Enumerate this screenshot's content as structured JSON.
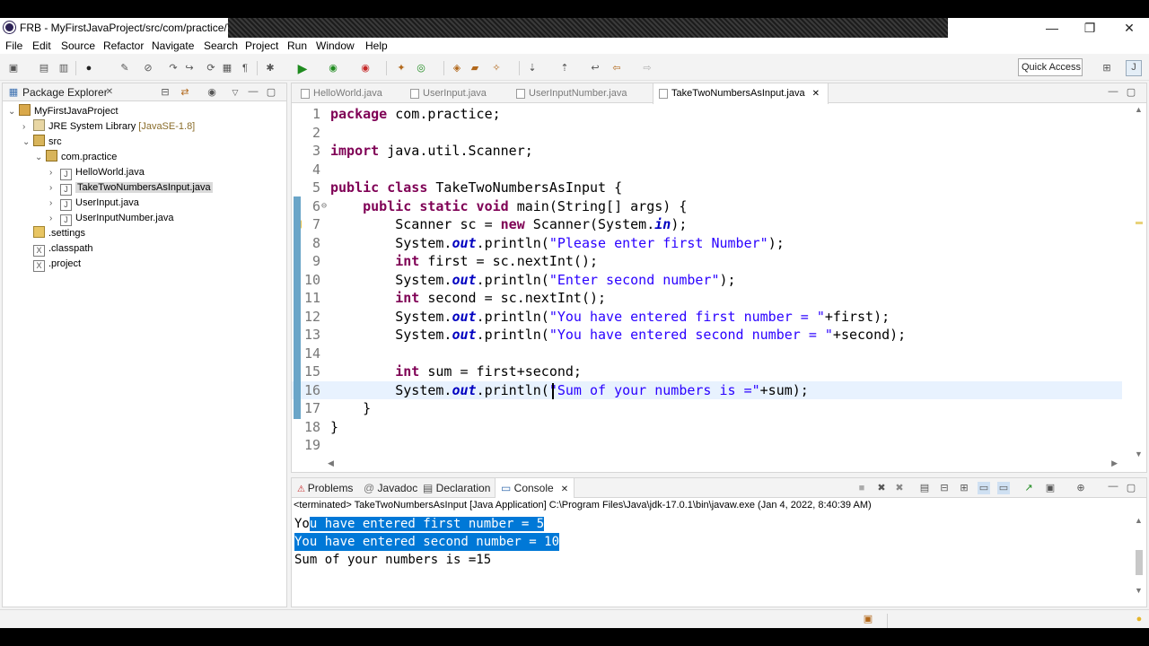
{
  "window": {
    "title": "FRB - MyFirstJavaProject/src/com/practice/TakeTwoNumbersAsInput.java - Eclipse IDE",
    "minimize": "—",
    "maximize": "❐",
    "close": "✕"
  },
  "menu": [
    "File",
    "Edit",
    "Source",
    "Refactor",
    "Navigate",
    "Search",
    "Project",
    "Run",
    "Window",
    "Help"
  ],
  "toolbar": {
    "quick_access": "Quick Access"
  },
  "package_explorer": {
    "title": "Package Explorer",
    "close": "✕",
    "project": "MyFirstJavaProject",
    "jre": "JRE System Library",
    "jre_version": "[JavaSE-1.8]",
    "src": "src",
    "package": "com.practice",
    "files": [
      "HelloWorld.java",
      "TakeTwoNumbersAsInput.java",
      "UserInput.java",
      "UserInputNumber.java"
    ],
    "others": [
      ".settings",
      ".classpath",
      ".project"
    ]
  },
  "editor": {
    "tabs": [
      "HelloWorld.java",
      "UserInput.java",
      "UserInputNumber.java",
      "TakeTwoNumbersAsInput.java"
    ],
    "active_tab": "TakeTwoNumbersAsInput.java",
    "tab_close": "✕",
    "line_numbers": [
      "1",
      "2",
      "3",
      "4",
      "5",
      "6",
      "7",
      "8",
      "9",
      "10",
      "11",
      "12",
      "13",
      "14",
      "15",
      "16",
      "17",
      "18",
      "19"
    ],
    "fold_marker": "⊖",
    "code": {
      "l1_kw": "package",
      "l1_rest": " com.practice;",
      "l3_kw": "import",
      "l3_rest": " java.util.Scanner;",
      "l5_kw": "public class",
      "l5_rest": " TakeTwoNumbersAsInput {",
      "l6_indent": "    ",
      "l6_kw": "public static void",
      "l6_rest": " main(String[] args) {",
      "l7_a": "        Scanner sc = ",
      "l7_kw": "new",
      "l7_b": " Scanner(System.",
      "l7_fld": "in",
      "l7_c": ");",
      "l8_a": "        System.",
      "l8_fld": "out",
      "l8_b": ".println(",
      "l8_str": "\"Please enter first Number\"",
      "l8_c": ");",
      "l9_indent": "        ",
      "l9_kw": "int",
      "l9_rest": " first = sc.nextInt();",
      "l10_a": "        System.",
      "l10_fld": "out",
      "l10_b": ".println(",
      "l10_str": "\"Enter second number\"",
      "l10_c": ");",
      "l11_indent": "        ",
      "l11_kw": "int",
      "l11_rest": " second = sc.nextInt();",
      "l12_a": "        System.",
      "l12_fld": "out",
      "l12_b": ".println(",
      "l12_str": "\"You have entered first number = \"",
      "l12_c": "+first);",
      "l13_a": "        System.",
      "l13_fld": "out",
      "l13_b": ".println(",
      "l13_str": "\"You have entered second number = \"",
      "l13_c": "+second);",
      "l15_indent": "        ",
      "l15_kw": "int",
      "l15_rest": " sum = first+second;",
      "l16_a": "        System.",
      "l16_fld": "out",
      "l16_b": ".println(",
      "l16_str": "\"Sum of your numbers is =\"",
      "l16_c": "+sum);",
      "l17": "    }",
      "l18": "}"
    }
  },
  "console": {
    "tabs": {
      "problems": "Problems",
      "javadoc": "Javadoc",
      "declaration": "Declaration",
      "console": "Console"
    },
    "close": "✕",
    "terminated": "<terminated> TakeTwoNumbersAsInput [Java Application] C:\\Program Files\\Java\\jdk-17.0.1\\bin\\javaw.exe (Jan 4, 2022, 8:40:39 AM)",
    "output": [
      "You have entered first number = 5",
      "You have entered second number = 10",
      "Sum of your numbers is =15"
    ]
  },
  "colors": {
    "keyword": "#7f0055",
    "string": "#2a00ff",
    "field": "#0000c0",
    "selection": "#0078d7"
  }
}
